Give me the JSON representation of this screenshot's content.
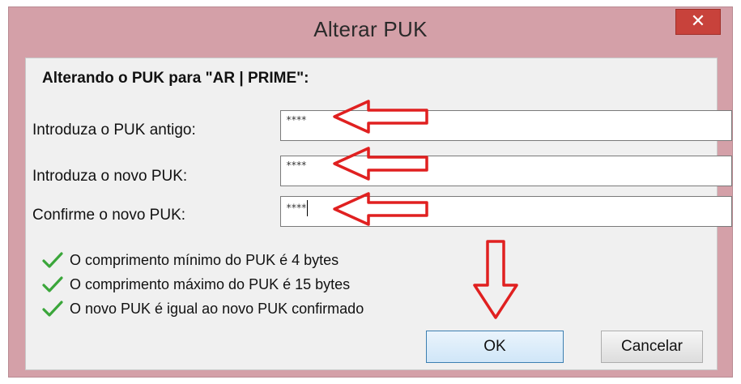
{
  "dialog": {
    "title": "Alterar PUK",
    "close_glyph": "✕",
    "heading": "Alterando o PUK para \"AR | PRIME\":"
  },
  "fields": [
    {
      "label": "Introduza o PUK antigo:",
      "value": "****"
    },
    {
      "label": "Introduza o novo PUK:",
      "value": "****"
    },
    {
      "label": "Confirme o novo PUK:",
      "value": "****"
    }
  ],
  "checks": [
    {
      "icon": "checkmark-icon",
      "text": "O comprimento mínimo do PUK é 4 bytes"
    },
    {
      "icon": "checkmark-icon",
      "text": "O comprimento máximo do PUK é 15 bytes"
    },
    {
      "icon": "checkmark-icon",
      "text": "O novo PUK é igual ao novo PUK confirmado"
    }
  ],
  "buttons": {
    "ok_label": "OK",
    "cancel_label": "Cancelar"
  },
  "colors": {
    "titlebar": "#d4a0a8",
    "close_button": "#c8423b",
    "check": "#3aa63a",
    "annotation_arrow": "#e02020"
  }
}
